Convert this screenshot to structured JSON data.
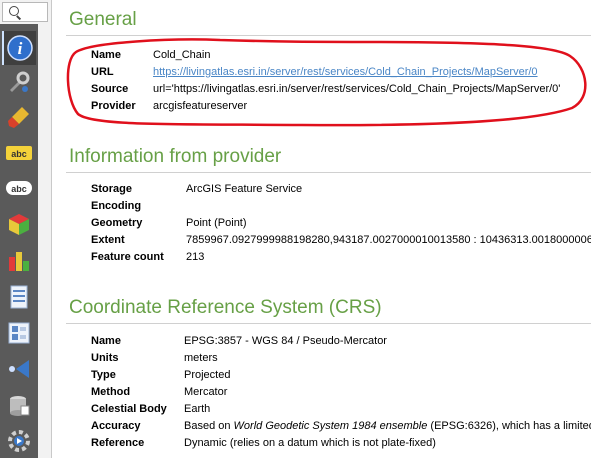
{
  "general": {
    "title": "General",
    "rows": [
      {
        "key": "Name",
        "value": "Cold_Chain"
      },
      {
        "key": "URL",
        "value": "https://livingatlas.esri.in/server/rest/services/Cold_Chain_Projects/MapServer/0"
      },
      {
        "key": "Source",
        "value": "url='https://livingatlas.esri.in/server/rest/services/Cold_Chain_Projects/MapServer/0'"
      },
      {
        "key": "Provider",
        "value": "arcgisfeatureserver"
      }
    ]
  },
  "provider": {
    "title": "Information from provider",
    "rows": [
      {
        "key": "Storage",
        "value": "ArcGIS Feature Service"
      },
      {
        "key": "Encoding",
        "value": ""
      },
      {
        "key": "Geometry",
        "value": "Point (Point)"
      },
      {
        "key": "Extent",
        "value": "7859967.0927999988198280,943187.0027000010013580 : 10436313.0018000006"
      },
      {
        "key": "Feature count",
        "value": "213"
      }
    ]
  },
  "crs": {
    "title": "Coordinate Reference System (CRS)",
    "rows": [
      {
        "key": "Name",
        "value": "EPSG:3857 - WGS 84 / Pseudo-Mercator"
      },
      {
        "key": "Units",
        "value": "meters"
      },
      {
        "key": "Type",
        "value": "Projected"
      },
      {
        "key": "Method",
        "value": "Mercator"
      },
      {
        "key": "Celestial Body",
        "value": "Earth"
      },
      {
        "key": "Reference",
        "value": "Dynamic (relies on a datum which is not plate-fixed)"
      }
    ],
    "accuracy": {
      "key": "Accuracy",
      "prefix": "Based on ",
      "italic": "World Geodetic System 1984 ensemble",
      "suffix": " (EPSG:6326), which has a limited"
    }
  },
  "sidebar": {
    "tabs": [
      "information-icon",
      "source-icon",
      "symbology-icon",
      "labels-icon",
      "masks-icon",
      "3d-view-icon",
      "diagrams-icon",
      "fields-icon",
      "attributes-form-icon",
      "joins-icon",
      "auxiliary-storage-icon",
      "actions-icon"
    ]
  },
  "colors": {
    "section_title": "#67a046",
    "link": "#4a86c6",
    "annotation": "#e0101c"
  }
}
